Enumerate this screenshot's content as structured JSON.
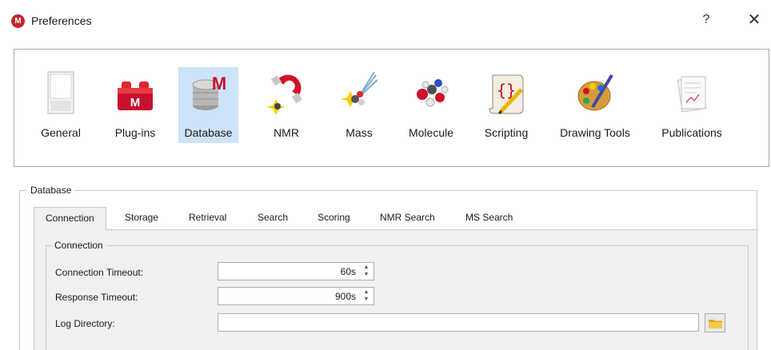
{
  "window": {
    "title": "Preferences",
    "help_glyph": "?",
    "close_glyph": "✕",
    "logo_glyph": "M"
  },
  "categories": [
    {
      "label": "General",
      "icon": "general-icon",
      "selected": false
    },
    {
      "label": "Plug-ins",
      "icon": "plugins-icon",
      "selected": false
    },
    {
      "label": "Database",
      "icon": "database-icon",
      "selected": true
    },
    {
      "label": "NMR",
      "icon": "nmr-icon",
      "selected": false
    },
    {
      "label": "Mass",
      "icon": "mass-icon",
      "selected": false
    },
    {
      "label": "Molecule",
      "icon": "molecule-icon",
      "selected": false
    },
    {
      "label": "Scripting",
      "icon": "scripting-icon",
      "selected": false
    },
    {
      "label": "Drawing Tools",
      "icon": "drawing-tools-icon",
      "selected": false
    },
    {
      "label": "Publications",
      "icon": "publications-icon",
      "selected": false
    }
  ],
  "database_group": {
    "title": "Database",
    "tabs": [
      "Connection",
      "Storage",
      "Retrieval",
      "Search",
      "Scoring",
      "NMR Search",
      "MS Search"
    ],
    "active_tab": "Connection",
    "connection": {
      "title": "Connection",
      "connection_timeout_label": "Connection Timeout:",
      "connection_timeout_value": "60s",
      "response_timeout_label": "Response Timeout:",
      "response_timeout_value": "900s",
      "log_directory_label": "Log Directory:",
      "log_directory_value": ""
    }
  },
  "colors": {
    "selection": "#cde3f7",
    "panel_bg": "#f0f0f0",
    "brand_red": "#c4262e"
  }
}
